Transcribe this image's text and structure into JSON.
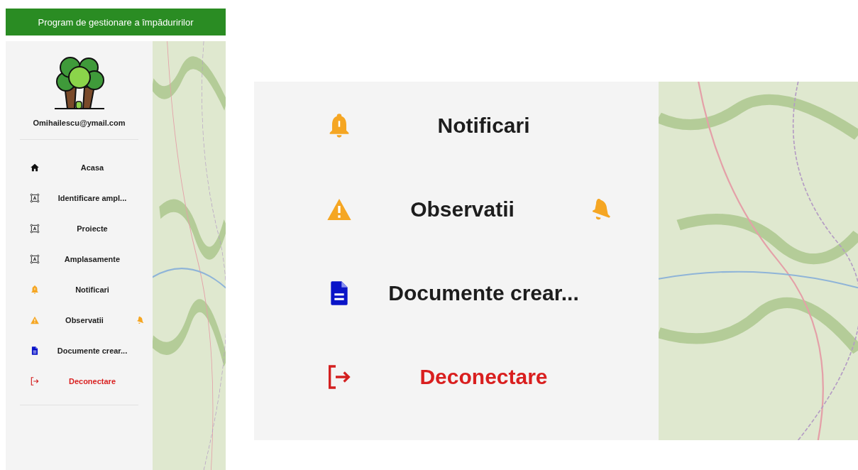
{
  "app": {
    "title": "Program de gestionare a împăduririlor",
    "user_email": "Omihailescu@ymail.com",
    "menu": [
      {
        "label": "Acasa",
        "kind": "home",
        "alert": false
      },
      {
        "label": "Identificare ampl...",
        "kind": "frame",
        "alert": false
      },
      {
        "label": "Proiecte",
        "kind": "frame",
        "alert": false
      },
      {
        "label": "Amplasamente",
        "kind": "frame",
        "alert": false
      },
      {
        "label": "Notificari",
        "kind": "bell",
        "alert": false
      },
      {
        "label": "Observatii",
        "kind": "warning",
        "alert": true
      },
      {
        "label": "Documente crear...",
        "kind": "document",
        "alert": false
      },
      {
        "label": "Deconectare",
        "kind": "logout",
        "alert": false
      }
    ]
  },
  "zoom_view": {
    "menu": [
      {
        "label": "Notificari",
        "kind": "bell",
        "alert": false
      },
      {
        "label": "Observatii",
        "kind": "warning",
        "alert": true
      },
      {
        "label": "Documente crear...",
        "kind": "document",
        "alert": false
      },
      {
        "label": "Deconectare",
        "kind": "logout",
        "alert": false
      }
    ]
  }
}
